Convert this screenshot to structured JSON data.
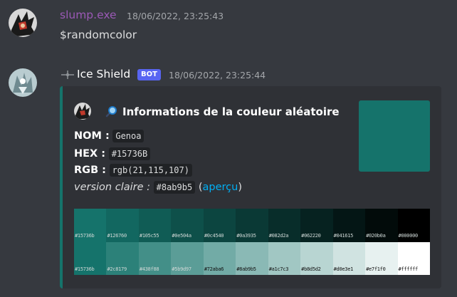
{
  "messages": [
    {
      "author": "slump.exe",
      "author_color": "#9b59b6",
      "timestamp": "18/06/2022, 23:25:43",
      "content": "$randomcolor"
    },
    {
      "author": "Ice Shield",
      "author_color": "#ffffff",
      "badge": "BOT",
      "timestamp": "18/06/2022, 23:25:44"
    }
  ],
  "embed": {
    "accent_color": "#15736b",
    "title_icon": "magnifier-icon",
    "title": "Informations de la couleur aléatoire",
    "fields": {
      "nom_label": "NOM :",
      "nom_value": "Genoa",
      "hex_label": "HEX :",
      "hex_value": "#15736B",
      "rgb_label": "RGB :",
      "rgb_value": "rgb(21,115,107)",
      "light_label": "version claire :",
      "light_value": "#8ab9b5",
      "light_link_open": "(",
      "light_link": "aperçu",
      "light_link_close": ")"
    },
    "thumbnail_color": "#15736b",
    "palette": {
      "shades": [
        "#15736b",
        "#126760",
        "#105c55",
        "#0e504a",
        "#0c4540",
        "#0a3935",
        "#082d2a",
        "#062220",
        "#041615",
        "#020b0a",
        "#000000"
      ],
      "tints": [
        "#15736b",
        "#2c8179",
        "#438f88",
        "#5b9d97",
        "#72aba6",
        "#8ab9b5",
        "#a1c7c3",
        "#b8d5d2",
        "#d0e3e1",
        "#e7f1f0",
        "#ffffff"
      ]
    }
  }
}
